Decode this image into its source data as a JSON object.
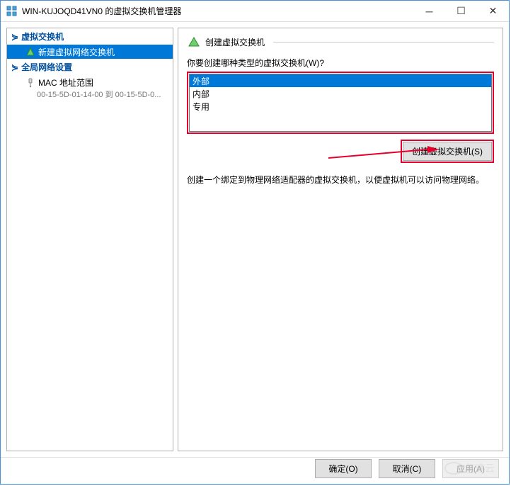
{
  "titlebar": {
    "title": "WIN-KUJOQD41VN0 的虚拟交换机管理器"
  },
  "tree": {
    "section1_title": "虚拟交换机",
    "new_switch": "新建虚拟网络交换机",
    "section2_title": "全局网络设置",
    "mac_range_title": "MAC 地址范围",
    "mac_range_value": "00-15-5D-01-14-00 到 00-15-5D-0..."
  },
  "right": {
    "header": "创建虚拟交换机",
    "prompt": "你要创建哪种类型的虚拟交换机(W)?",
    "options": {
      "external": "外部",
      "internal": "内部",
      "private": "专用"
    },
    "create_btn": "创建虚拟交换机(S)",
    "description": "创建一个绑定到物理网络适配器的虚拟交换机，以便虚拟机可以访问物理网络。"
  },
  "footer": {
    "ok": "确定(O)",
    "cancel": "取消(C)",
    "apply": "应用(A)"
  },
  "watermark": "亿速云"
}
